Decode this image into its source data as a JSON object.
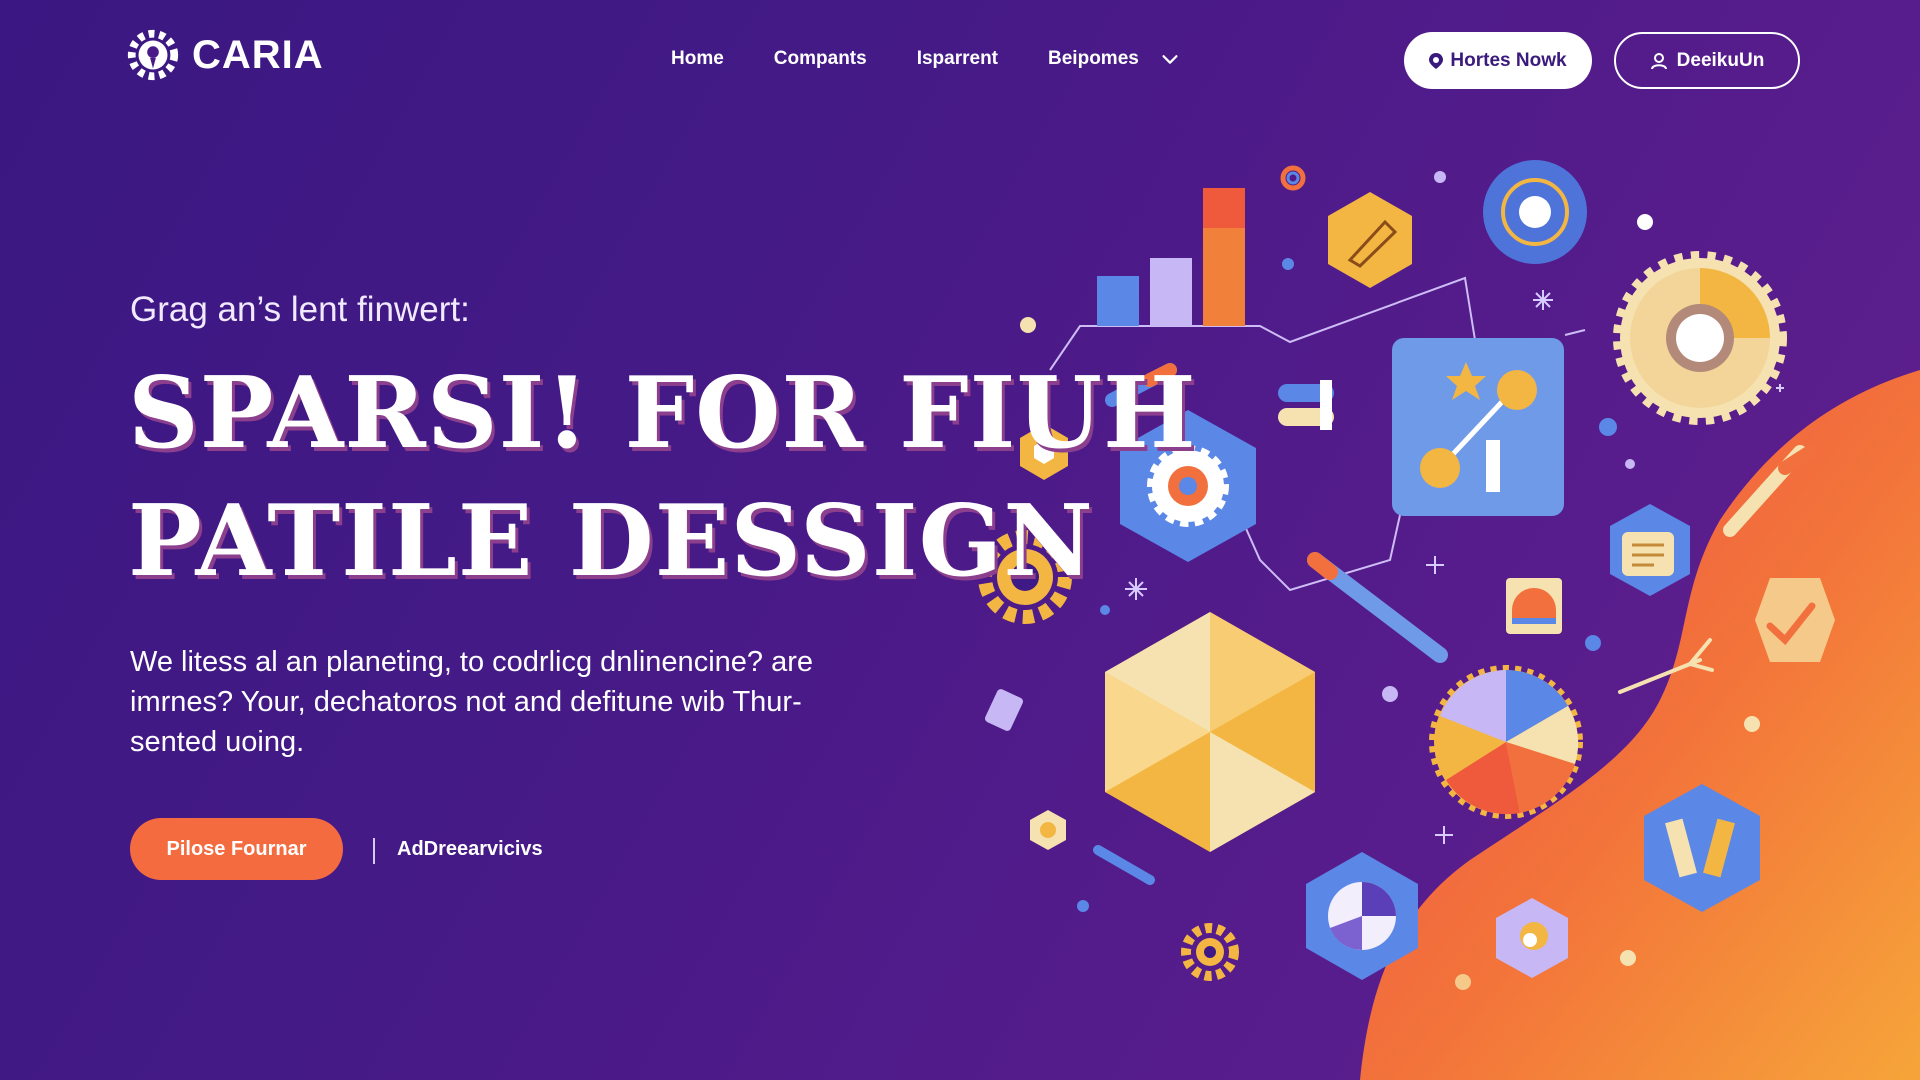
{
  "brand": {
    "name": "CARIA",
    "icon": "gear-flower-logo"
  },
  "nav": {
    "items": [
      "Home",
      "Compants",
      "Isparrent",
      "Beipomes"
    ],
    "dropdown_icon": "chevron-down-icon",
    "primary_button": {
      "label": "Hortes Nowk",
      "icon": "location-pin-icon"
    },
    "secondary_button": {
      "label": "DeeikuUn",
      "icon": "user-icon"
    }
  },
  "hero": {
    "eyebrow": "Grag an’s lent finwert:",
    "headline_line1": "SPARSI! FOR FIUH",
    "headline_line2": "PATILE DESSIGN",
    "description": "We litess al an planeting, to codrlicg dnlinencine? are imrnes? Your, dechatoros not and defitune wib Thur-sented uoing.",
    "cta_label": "Pilose Fournar",
    "secondary_link": "AdDreearvicivs"
  },
  "colors": {
    "bg_start": "#3a1782",
    "bg_end": "#63208f",
    "accent_orange": "#f46b3f",
    "gold": "#f3b642",
    "blue": "#5b87e6",
    "lavender": "#c7b8f5"
  }
}
